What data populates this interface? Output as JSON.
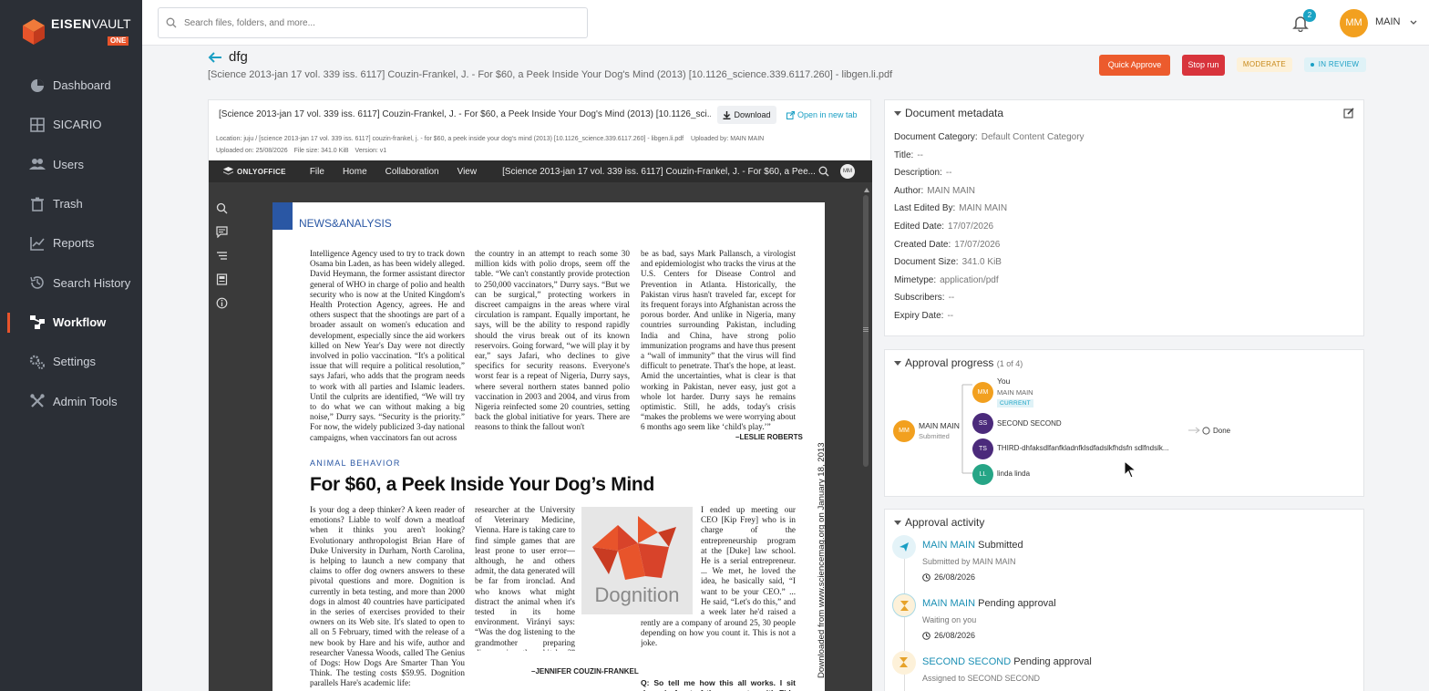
{
  "app": {
    "logo_word1": "EISEN",
    "logo_word2": "VAULT",
    "logo_badge": "ONE",
    "colors": {
      "accent": "#e8542b",
      "sidebar": "#2b2f36",
      "link": "#1a8fb4"
    }
  },
  "sidebar": {
    "items": [
      {
        "label": "Dashboard",
        "icon": "dashboard-icon"
      },
      {
        "label": "SICARIO",
        "icon": "grid-icon"
      },
      {
        "label": "Users",
        "icon": "users-icon"
      },
      {
        "label": "Trash",
        "icon": "trash-icon"
      },
      {
        "label": "Reports",
        "icon": "chart-icon"
      },
      {
        "label": "Search History",
        "icon": "history-icon"
      },
      {
        "label": "Workflow",
        "icon": "workflow-icon",
        "active": true
      },
      {
        "label": "Settings",
        "icon": "gear-icon"
      },
      {
        "label": "Admin Tools",
        "icon": "tools-icon"
      }
    ]
  },
  "topbar": {
    "search_placeholder": "Search files, folders, and more...",
    "notification_count": "2",
    "user_initials": "MM",
    "user_name": "MAIN"
  },
  "header": {
    "title": "dfg",
    "subtitle": "[Science 2013-jan 17 vol. 339 iss. 6117] Couzin-Frankel, J. - For $60, a Peek Inside Your Dog's Mind (2013) [10.1126_science.339.6117.260] - libgen.li.pdf",
    "quick_approve": "Quick Approve",
    "stop_run": "Stop run",
    "priority": "MODERATE",
    "status": "IN REVIEW"
  },
  "viewer": {
    "file_name": "[Science 2013-jan 17 vol. 339 iss. 6117] Couzin-Frankel, J. - For $60, a Peek Inside Your Dog's Mind (2013) [10.1126_sci...",
    "download": "Download",
    "open_new_tab": "Open in new tab",
    "location": "Location: juju / [science 2013-jan 17 vol. 339 iss. 6117] couzin-frankel, j. - for $60, a peek inside your dog's mind (2013) [10.1126_science.339.6117.260] - libgen.li.pdf",
    "uploaded_by": "Uploaded by: MAIN MAIN",
    "uploaded_on": "Uploaded on: 25/08/2026",
    "file_size": "File size: 341.0 KiB",
    "version": "Version: v1"
  },
  "onlyoffice": {
    "brand": "ONLYOFFICE",
    "menus": [
      "File",
      "Home",
      "Collaboration",
      "View"
    ],
    "doc_title": "[Science 2013-jan 17 vol. 339 iss. 6117] Couzin-Frankel, J. - For $60, a Pee...",
    "avatar": "MM",
    "page": {
      "section": "NEWS&ANALYSIS",
      "col1": "Intelligence Agency used to try to track down Osama bin Laden, as has been widely alleged. David Heymann, the former assistant director general of WHO in charge of polio and health security who is now at the United Kingdom's Health Protection Agency, agrees. He and others suspect that the shootings are part of a broader assault on women's education and development, especially since the aid workers killed on New Year's Day were not directly involved in polio vaccination. “It's a political issue that will require a political resolution,” says Jafari, who adds that the program needs to work with all parties and Islamic leaders. Until the culprits are identified, “We will try to do what we can without making a big noise,” Durry says. “Security is the priority.” For now, the widely publicized 3-day national campaigns, when vaccinators fan out across",
      "col2": "the country in an attempt to reach some 30 million kids with polio drops, seem off the table. “We can't constantly provide protection to 250,000 vaccinators,” Durry says. “But we can be surgical,” protecting workers in discreet campaigns in the areas where viral circulation is rampant. Equally important, he says, will be the ability to respond rapidly should the virus break out of its known reservoirs. Going forward, “we will play it by ear,” says Jafari, who declines to give specifics for security reasons. Everyone's worst fear is a repeat of Nigeria, Durry says, where several northern states banned polio vaccination in 2003 and 2004, and virus from Nigeria reinfected some 20 countries, setting back the global initiative for years. There are reasons to think the fallout won't",
      "col3": "be as bad, says Mark Pallansch, a virologist and epidemiologist who tracks the virus at the U.S. Centers for Disease Control and Prevention in Atlanta. Historically, the Pakistan virus hasn't traveled far, except for its frequent forays into Afghanistan across the porous border. And unlike in Nigeria, many countries surrounding Pakistan, including India and China, have strong polio immunization programs and have thus present a “wall of immunity” that the virus will find difficult to penetrate. That's the hope, at least. Amid the uncertainties, what is clear is that working in Pakistan, never easy, just got a whole lot harder. Durry says he remains optimistic. Still, he adds, today's crisis “makes the problems we were worrying about 6 months ago seem like ‘child's play.’”",
      "sig1": "–LESLIE ROBERTS",
      "label": "ANIMAL BEHAVIOR",
      "headline": "For $60, a Peek Inside Your Dog’s Mind",
      "b1": "Is your dog a deep thinker? A keen reader of emotions? Liable to wolf down a meatloaf when it thinks you aren't looking? Evolutionary anthropologist Brian Hare of Duke University in Durham, North Carolina, is helping to launch a new company that claims to offer dog owners answers to these pivotal questions and more. Dognition is currently in beta testing, and more than 2000 dogs in almost 40 countries have participated in the series of exercises provided to their owners on its Web site. It's slated to open to all on 5 February, timed with the release of a new book by Hare and his wife, author and researcher Vanessa Woods, called The Genius of Dogs: How Dogs Are Smarter Than You Think. The testing costs $59.95. Dognition parallels Hare's academic life:",
      "b2": "researcher at the University of Veterinary Medicine, Vienna. Hare is taking care to find simple games that are least prone to user error—although, he and others admit, the data generated will be far from ironclad. And who knows what might distract the animal when it's tested in its home environment. Virányi says: “Was the dog listening to the grandmother preparing dinner in the kitchen?” Science spoke with Hare last week. The interview was edited for brevity and clarity.",
      "sig2": "–JENNIFER COUZIN-FRANKEL",
      "b3": "I ended up meeting our CEO [Kip Frey] who is in charge of the entrepreneurship program at the [Duke] law school. He is a serial entrepreneur. ... We met, he loved the idea, he basically said, “I want to be your CEO.” ... He said, “Let's do this,” and a week later he'd raised a million dollars. ... We currently are a company of around 25, 30 people depending on how you count it. This is not a joke.",
      "qa": "Q: So tell me how this all works. I sit down in front of the computer with Fido and",
      "img_word": "Dognition",
      "vertical": "Downloaded from www.sciencemag.org on January 18, 2013"
    }
  },
  "metadata": {
    "title": "Document metadata",
    "rows": [
      {
        "k": "Document Category:",
        "v": "Default Content Category"
      },
      {
        "k": "Title:",
        "v": "--"
      },
      {
        "k": "Description:",
        "v": "--"
      },
      {
        "k": "Author:",
        "v": "MAIN MAIN"
      },
      {
        "k": "Last Edited By:",
        "v": "MAIN MAIN"
      },
      {
        "k": "Edited Date:",
        "v": "17/07/2026"
      },
      {
        "k": "Created Date:",
        "v": "17/07/2026"
      },
      {
        "k": "Document Size:",
        "v": "341.0 KiB"
      },
      {
        "k": "Mimetype:",
        "v": "application/pdf"
      },
      {
        "k": "Subscribers:",
        "v": "--"
      },
      {
        "k": "Expiry Date:",
        "v": "--"
      }
    ]
  },
  "approval": {
    "title": "Approval progress",
    "count": "(1 of 4)",
    "submitter": {
      "initials": "MM",
      "name": "MAIN MAIN",
      "state": "Submitted"
    },
    "approvers": [
      {
        "initials": "MM",
        "top": "You",
        "name": "MAIN MAIN",
        "badge": "CURRENT",
        "color": "#f2a01f"
      },
      {
        "initials": "SS",
        "name": "SECOND SECOND",
        "color": "#4b2a7b"
      },
      {
        "initials": "TS",
        "name": "THIRD-dhfaksdlfanfkladnfklsdfadslkfhdsfn sdlfndslk...",
        "color": "#4b2a7b"
      },
      {
        "initials": "LL",
        "name": "linda linda",
        "color": "#26a586"
      }
    ],
    "done": "Done"
  },
  "activity": {
    "title": "Approval activity",
    "items": [
      {
        "who": "MAIN MAIN",
        "what": "Submitted",
        "sub": "Submitted by MAIN MAIN",
        "date": "26/08/2026",
        "icon": "send-icon"
      },
      {
        "who": "MAIN MAIN",
        "what": "Pending approval",
        "sub": "Waiting on you",
        "date": "26/08/2026",
        "icon": "hourglass-icon"
      },
      {
        "who": "SECOND SECOND",
        "what": "Pending approval",
        "sub": "Assigned to SECOND SECOND",
        "date": "",
        "icon": "hourglass-icon"
      }
    ]
  }
}
